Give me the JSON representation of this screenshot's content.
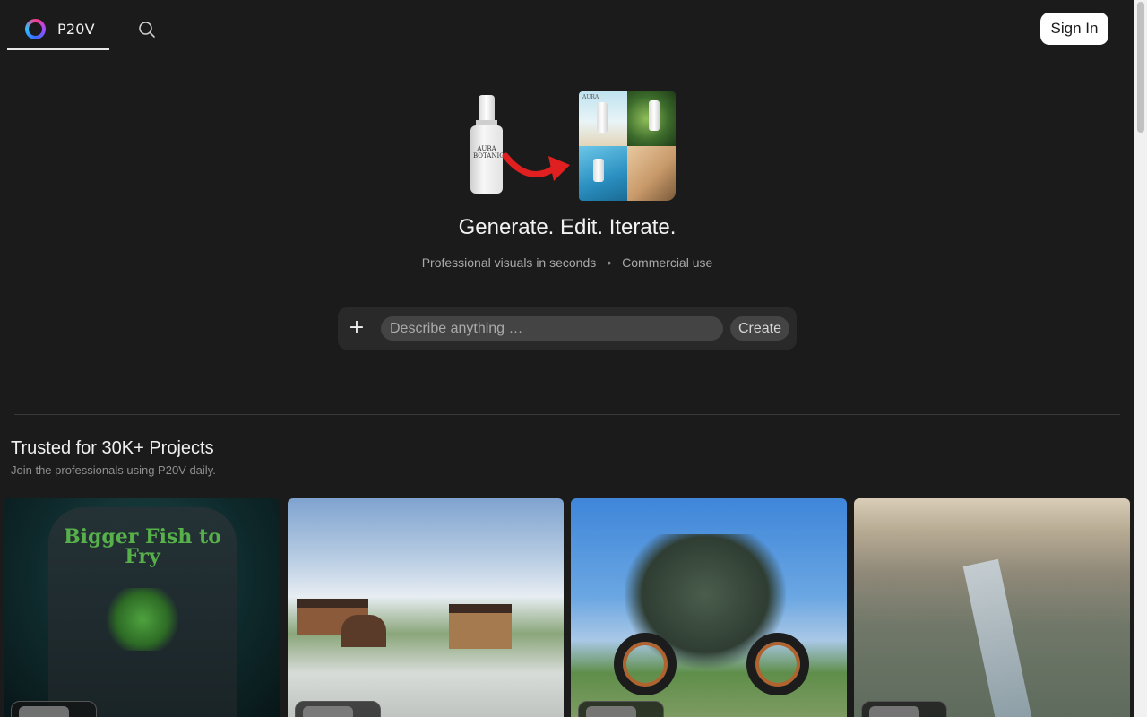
{
  "header": {
    "brand_name": "P20V",
    "sign_in_label": "Sign In"
  },
  "hero": {
    "title": "Generate. Edit. Iterate.",
    "subtitle_left": "Professional visuals in seconds",
    "subtitle_separator": "•",
    "subtitle_right": "Commercial use",
    "product_label_line1": "AURA",
    "product_label_line2": "BOTANICS"
  },
  "prompt": {
    "add_label": "+",
    "placeholder": "Describe anything …",
    "create_label": "Create"
  },
  "section": {
    "title": "Trusted for 30K+ Projects",
    "subtitle": "Join the professionals using P20V daily."
  },
  "gallery": {
    "card1_shirt_text": "Bigger Fish to Fry"
  },
  "icons": {
    "logo": "p20v-logo-icon",
    "search": "search-icon",
    "arrow": "red-arrow-icon",
    "plus": "plus-icon"
  },
  "colors": {
    "background": "#1c1b1c",
    "sign_in_bg": "#ffffff",
    "arrow": "#e02020",
    "input_bg": "#454445"
  }
}
